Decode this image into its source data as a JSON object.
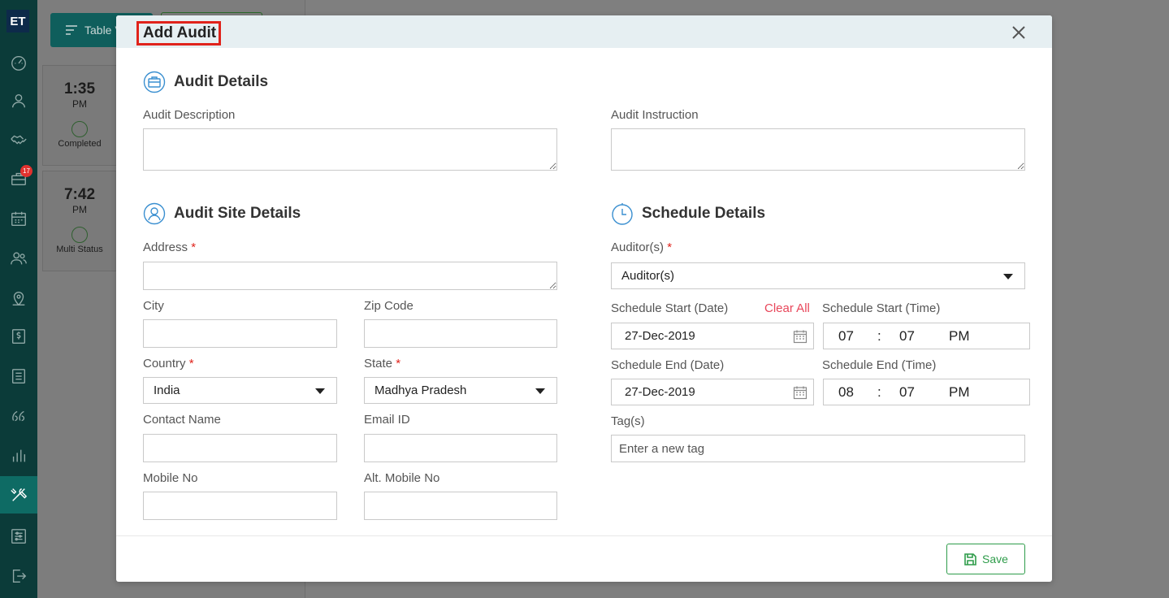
{
  "sidebar": {
    "logo": "ET",
    "badge_count": "17",
    "items": [
      {
        "icon": "dashboard-icon"
      },
      {
        "icon": "user-icon"
      },
      {
        "icon": "handshake-icon"
      },
      {
        "icon": "briefcase-icon"
      },
      {
        "icon": "calendar-icon"
      },
      {
        "icon": "users-icon"
      },
      {
        "icon": "location-icon"
      },
      {
        "icon": "dollar-icon"
      },
      {
        "icon": "list-icon"
      },
      {
        "icon": "quote-icon"
      },
      {
        "icon": "bar-chart-icon"
      },
      {
        "icon": "tools-icon"
      },
      {
        "icon": "settings-sliders-icon"
      },
      {
        "icon": "logout-icon"
      }
    ],
    "active_index": 11
  },
  "background": {
    "table_button_label": "Table V",
    "cards": [
      {
        "time": "1:35",
        "period": "PM",
        "status": "Completed"
      },
      {
        "time": "7:42",
        "period": "PM",
        "status": "Multi Status"
      }
    ]
  },
  "modal": {
    "title": "Add Audit",
    "audit_details": {
      "title": "Audit Details",
      "description_label": "Audit Description",
      "description_value": "",
      "instruction_label": "Audit Instruction",
      "instruction_value": ""
    },
    "site_details": {
      "title": "Audit Site Details",
      "address_label": "Address",
      "address_value": "",
      "city_label": "City",
      "city_value": "",
      "zip_label": "Zip Code",
      "zip_value": "",
      "country_label": "Country",
      "country_value": "India",
      "state_label": "State",
      "state_value": "Madhya Pradesh",
      "contact_label": "Contact Name",
      "contact_value": "",
      "email_label": "Email ID",
      "email_value": "",
      "mobile_label": "Mobile No",
      "mobile_value": "",
      "alt_mobile_label": "Alt. Mobile No",
      "alt_mobile_value": ""
    },
    "schedule": {
      "title": "Schedule Details",
      "auditors_label": "Auditor(s)",
      "auditors_value": "Auditor(s)",
      "start_date_label": "Schedule Start (Date)",
      "clear_all": "Clear All",
      "start_time_label": "Schedule Start (Time)",
      "start_date": "27-Dec-2019",
      "start_hour": "07",
      "start_minute": "07",
      "start_ampm": "PM",
      "end_date_label": "Schedule End (Date)",
      "end_time_label": "Schedule End (Time)",
      "end_date": "27-Dec-2019",
      "end_hour": "08",
      "end_minute": "07",
      "end_ampm": "PM",
      "time_separator": ":",
      "tags_label": "Tag(s)",
      "tags_placeholder": "Enter a new tag"
    },
    "required_mark": "*",
    "save_label": "Save"
  },
  "colors": {
    "sidebar_bg": "#0b3b39",
    "sidebar_active": "#0e6b64",
    "header_bg": "#e6eff2",
    "accent_blue": "#3a8fd0",
    "save_green": "#2e9c4a",
    "required_red": "#e0231b",
    "clear_all_red": "#e8465a"
  }
}
